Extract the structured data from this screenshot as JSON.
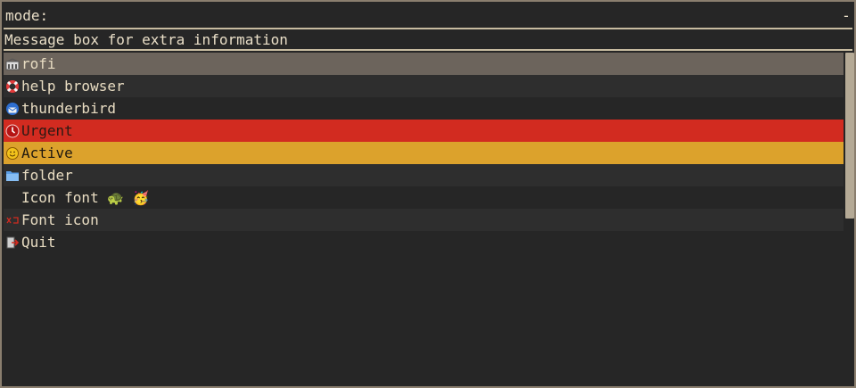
{
  "inputbar": {
    "prompt": "mode:",
    "case_indicator": "-"
  },
  "message": "Message box for extra information",
  "entries": [
    {
      "label": "rofi",
      "icon": "rofi-icon",
      "state": "selected"
    },
    {
      "label": "help browser",
      "icon": "lifebuoy-icon",
      "state": "alt"
    },
    {
      "label": "thunderbird",
      "icon": "thunderbird-icon",
      "state": "normal"
    },
    {
      "label": "Urgent",
      "icon": "urgent-clock-icon",
      "state": "urgent"
    },
    {
      "label": "Active",
      "icon": "smiley-icon",
      "state": "active"
    },
    {
      "label": "folder",
      "icon": "folder-icon",
      "state": "alt"
    },
    {
      "label": "Icon font ",
      "icon": "",
      "state": "normal",
      "emoji": [
        "🐢",
        "🥳"
      ]
    },
    {
      "label": "Font icon",
      "icon": "font-glyph-icon",
      "state": "alt"
    },
    {
      "label": "Quit",
      "icon": "exit-icon",
      "state": "normal"
    }
  ],
  "colors": {
    "selected": "#6c645c",
    "urgent": "#d22b20",
    "active": "#dca22c",
    "text": "#e8dcc2"
  }
}
